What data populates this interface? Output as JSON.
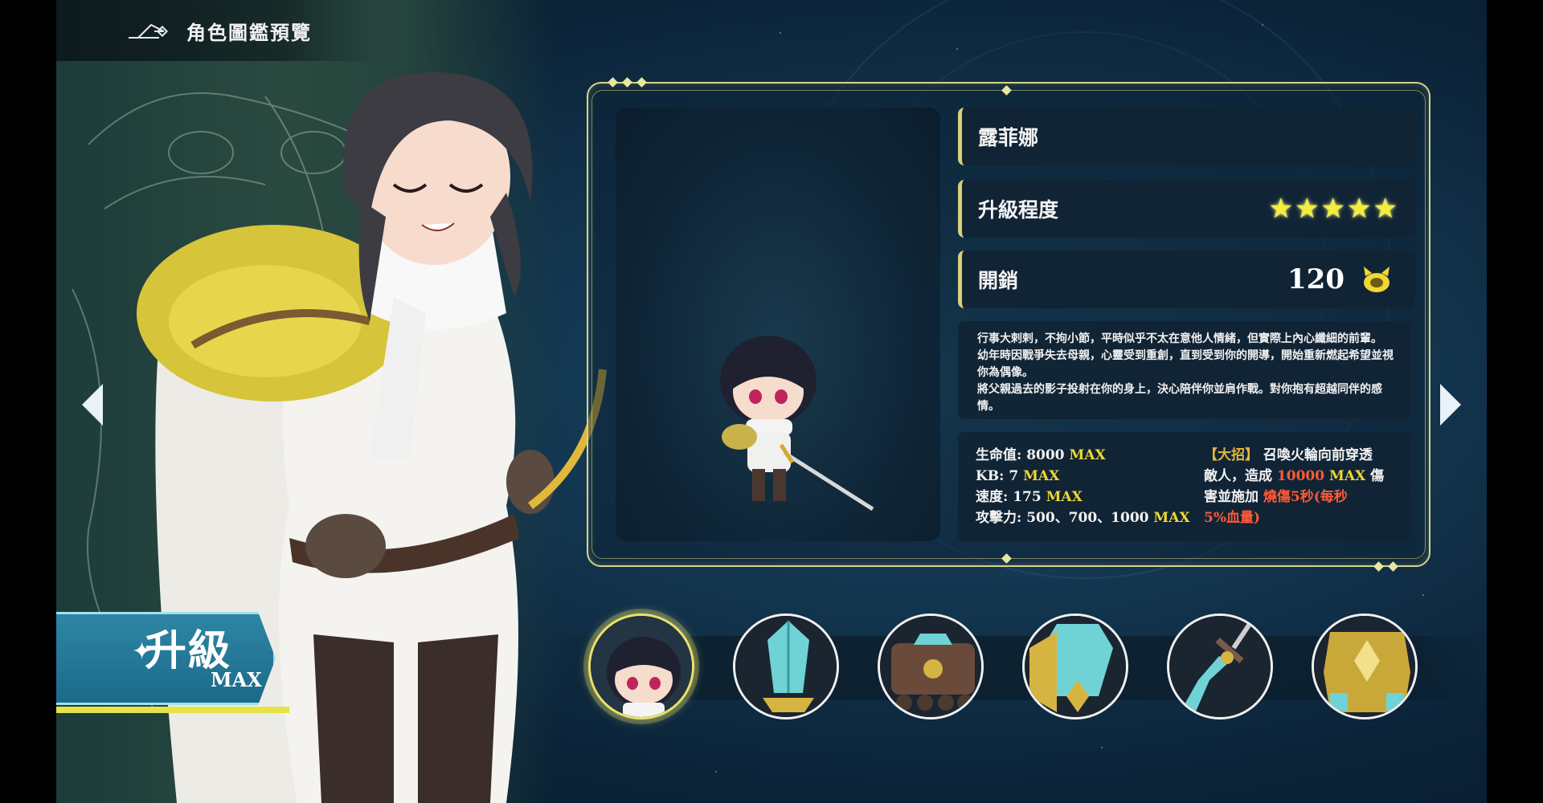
{
  "header": {
    "title": "角色圖鑑預覽"
  },
  "character": {
    "name": "露菲娜",
    "level_label": "升級程度",
    "stars": 5,
    "star_glyph": "★",
    "cost_label": "開銷",
    "cost_value": "120",
    "description": [
      "行事大剌剌，不拘小節，平時似乎不太在意他人情緒，但實際上內心纖細的前輩。",
      "幼年時因戰爭失去母親，心靈受到重創，直到受到你的開導，開始重新燃起希望並視你為偶像。",
      "將父親過去的影子投射在你的身上，決心陪伴你並肩作戰。對你抱有超越同伴的感情。"
    ],
    "stats": {
      "hp_label": "生命值: 8000",
      "hp_max": "MAX",
      "kb_label": "KB: 7",
      "kb_max": "MAX",
      "speed_label": "速度: 175",
      "speed_max": "MAX",
      "atk_label": "攻擊力: 500、700、1000",
      "atk_max": "MAX"
    },
    "skill": {
      "tag": "【大招】",
      "line1": "召喚火輪向前穿透",
      "line2_a": "敵人，造成",
      "line2_dmg": "10000",
      "line2_max": "MAX",
      "line2_b": "傷",
      "line3_a": "害並施加",
      "line3_burn": "燒傷5秒(每秒",
      "line4_burn": "5%血量)"
    }
  },
  "upgrade_badge": {
    "title": "升級",
    "sub": "MAX",
    "spark": "✦"
  },
  "thumbnails": [
    {
      "name": "character-chibi",
      "selected": true
    },
    {
      "name": "crystal-sword"
    },
    {
      "name": "treasure-cart"
    },
    {
      "name": "crystal-shield"
    },
    {
      "name": "crystal-blade"
    },
    {
      "name": "gold-armor"
    }
  ],
  "colors": {
    "accent_gold": "#d6d48a",
    "max_yellow": "#efd833",
    "burn_red": "#ff5a36",
    "badge_blue": "#2e86a4"
  }
}
